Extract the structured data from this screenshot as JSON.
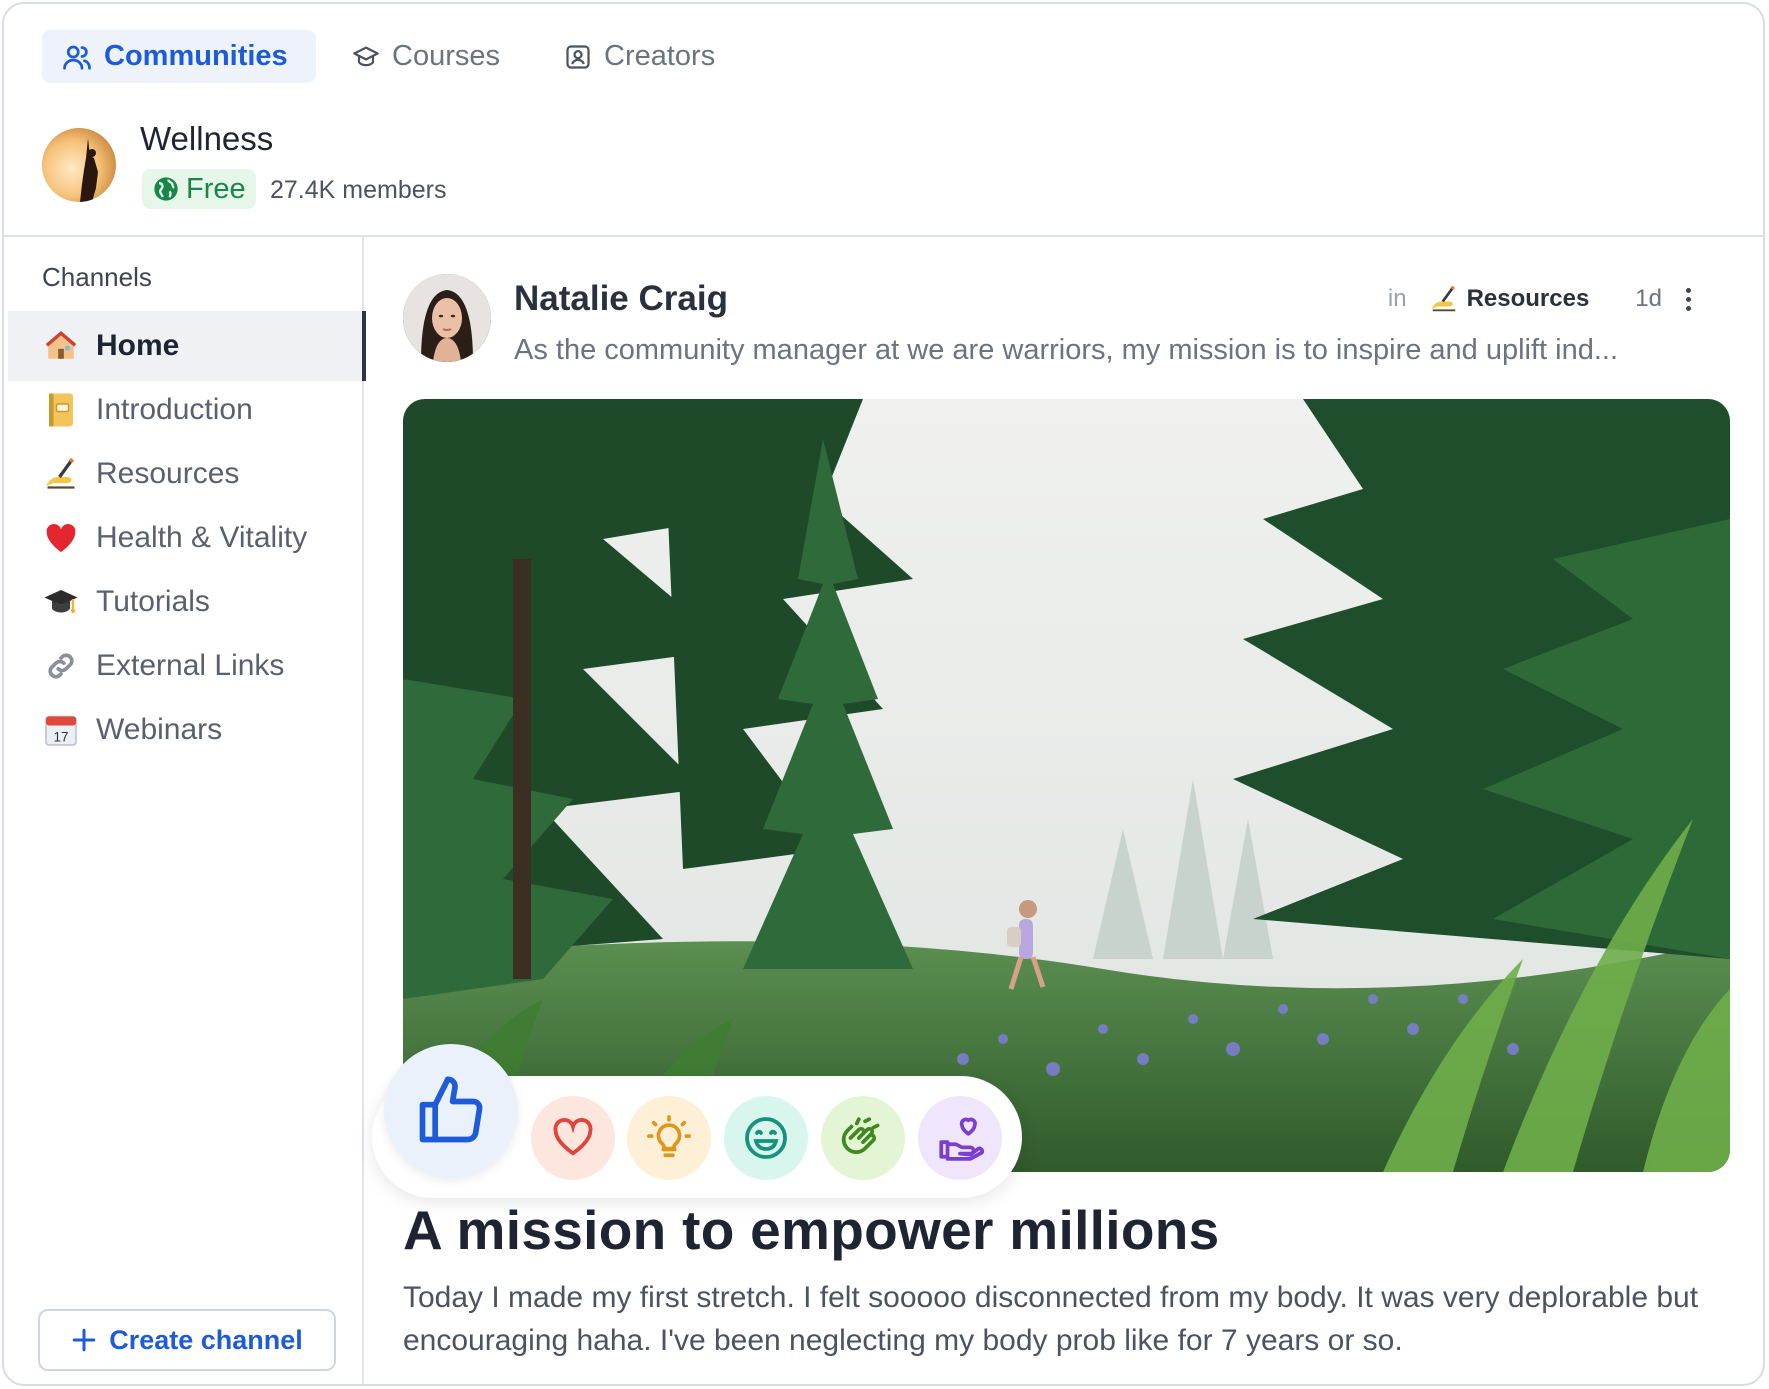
{
  "nav": {
    "tabs": [
      {
        "label": "Communities",
        "icon": "users-icon",
        "active": true
      },
      {
        "label": "Courses",
        "icon": "graduation-cap-icon",
        "active": false
      },
      {
        "label": "Creators",
        "icon": "id-badge-icon",
        "active": false
      }
    ]
  },
  "community": {
    "name": "Wellness",
    "badge": "Free",
    "members": "27.4K members"
  },
  "sidebar": {
    "heading": "Channels",
    "items": [
      {
        "label": "Home",
        "emoji": "🏠",
        "active": true
      },
      {
        "label": "Introduction",
        "emoji": "📒"
      },
      {
        "label": "Resources",
        "emoji": "✍️"
      },
      {
        "label": "Health & Vitality",
        "emoji": "❤️"
      },
      {
        "label": "Tutorials",
        "emoji": "🎓"
      },
      {
        "label": "External Links",
        "emoji": "🔗"
      },
      {
        "label": "Webinars",
        "emoji": "📅"
      }
    ],
    "create_label": "Create channel"
  },
  "post": {
    "author": "Natalie Craig",
    "in_label": "in",
    "channel_emoji": "✍️",
    "channel": "Resources",
    "age": "1d",
    "excerpt": "As the community manager at we are warriors, my mission is to inspire and uplift ind...",
    "title": "A mission to empower millions",
    "body": "Today I made my first stretch. I felt sooooo disconnected from my body. It was very deplorable but encouraging haha. I've been neglecting my body prob like for 7 years or so."
  },
  "reactions": [
    {
      "name": "like",
      "color": "#1e5bd8",
      "bg": "#eaf1fb"
    },
    {
      "name": "love",
      "color": "#e0443a",
      "bg": "#fde6de"
    },
    {
      "name": "idea",
      "color": "#e0961a",
      "bg": "#fdf0d6"
    },
    {
      "name": "smile",
      "color": "#15927a",
      "bg": "#d9f6ee"
    },
    {
      "name": "clap",
      "color": "#3f8a1e",
      "bg": "#e4f5d6"
    },
    {
      "name": "care",
      "color": "#7a3fd0",
      "bg": "#efe6fb"
    }
  ],
  "colors": {
    "accent": "#1e5bd8",
    "success": "#18864b"
  }
}
